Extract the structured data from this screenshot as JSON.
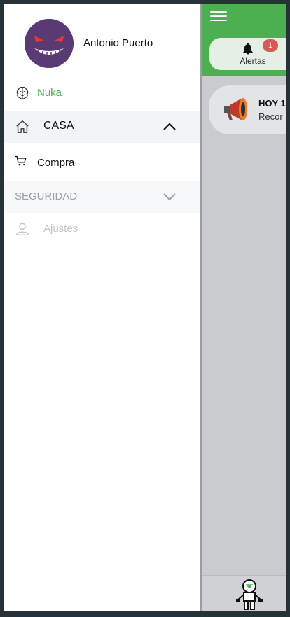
{
  "app": {
    "alerts": {
      "label": "Alertas",
      "count": "1"
    },
    "news": {
      "title": "HOY 1",
      "subtitle": "Recor"
    }
  },
  "drawer": {
    "profile": {
      "name": "Antonio Puerto",
      "avatar_icon": "ghost-avatar"
    },
    "items": [
      {
        "label": "Nuka",
        "icon": "brain-icon",
        "color": "#4caf50"
      },
      {
        "label": "CASA",
        "icon": "home-icon",
        "expanded": true
      },
      {
        "label": "Compra",
        "icon": "cart-icon"
      },
      {
        "label": "SEGURIDAD",
        "icon": "",
        "expanded": false
      },
      {
        "label": "Ajustes",
        "icon": "user-icon"
      }
    ]
  },
  "colors": {
    "accent": "#4caf50",
    "badge": "#e05555",
    "drawer_bg": "#ffffff",
    "overlay": "#c9cbcf"
  }
}
